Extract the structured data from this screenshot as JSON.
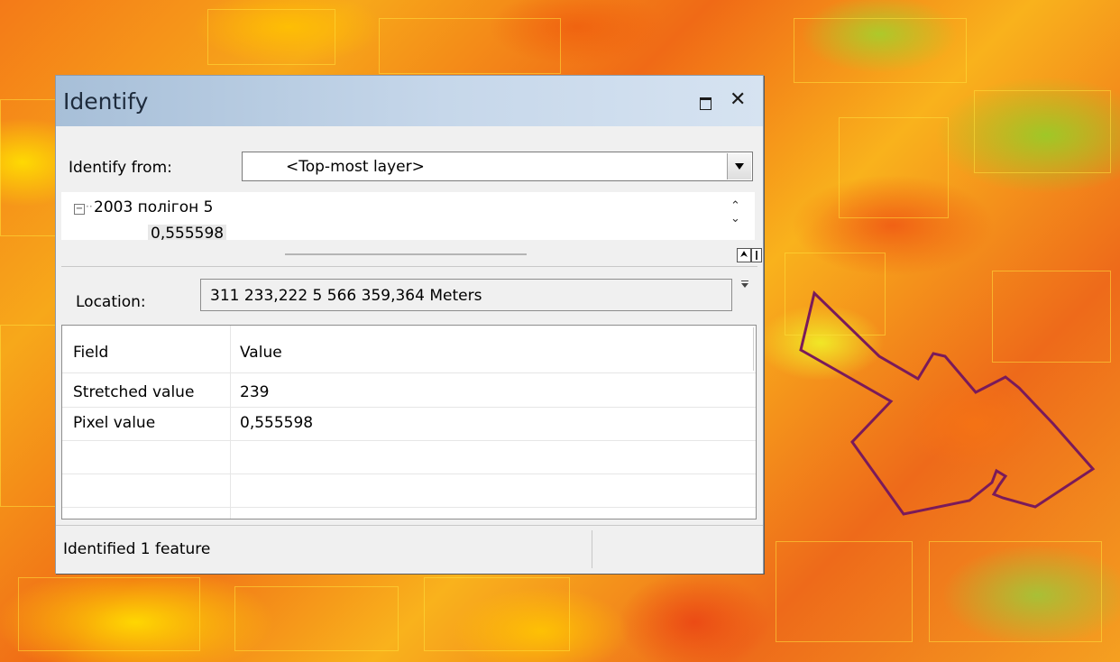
{
  "window": {
    "title": "Identify",
    "maximize_icon": "maximize-icon",
    "close_label": "✕"
  },
  "identify_from": {
    "label": "Identify from:",
    "value": "<Top-most layer>"
  },
  "tree": {
    "expander": "−",
    "root": "2003 полігон 5",
    "child": "0,555598"
  },
  "location": {
    "label": "Location:",
    "value": "311 233,222  5 566 359,364 Meters"
  },
  "attributes": {
    "columns": [
      "Field",
      "Value"
    ],
    "rows": [
      {
        "field": "Stretched value",
        "value": "239"
      },
      {
        "field": "Pixel value",
        "value": "0,555598"
      }
    ]
  },
  "status": {
    "text": "Identified 1 feature"
  },
  "colors": {
    "polygon_outline": "#7a1a5a",
    "titlebar_start": "#a7bfd8",
    "titlebar_end": "#d6e3f1"
  }
}
